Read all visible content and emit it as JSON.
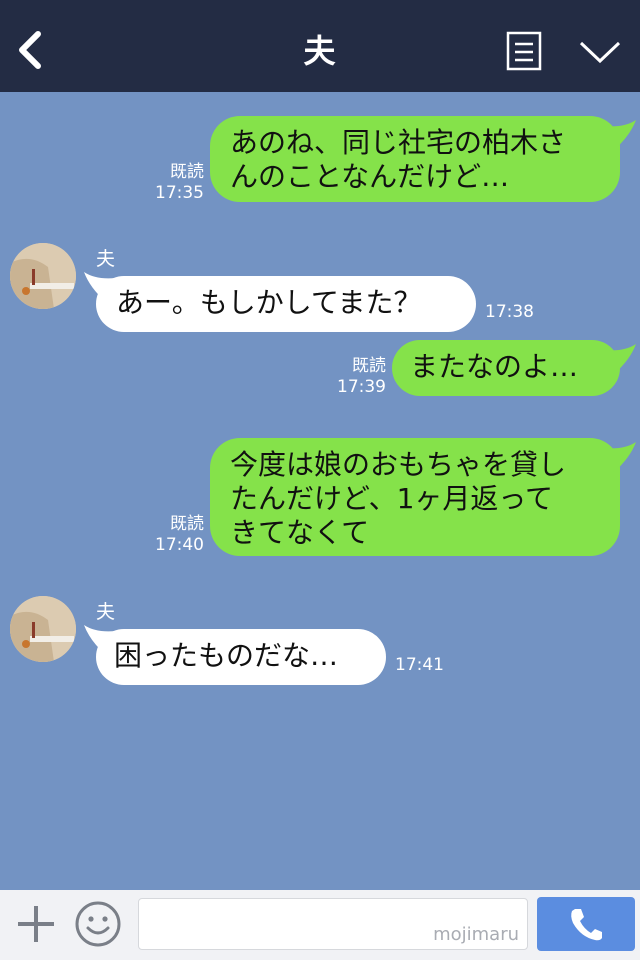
{
  "header": {
    "title": "夫",
    "back_icon": "chevron-left-icon",
    "menu_icon": "memo-icon",
    "collapse_icon": "chevron-down-icon"
  },
  "colors": {
    "header_bg": "#232c44",
    "chat_bg": "#7393c3",
    "outgoing_bubble": "#85e24a",
    "incoming_bubble": "#ffffff",
    "call_button": "#5b8de0"
  },
  "messages": [
    {
      "direction": "out",
      "text": "あのね、同じ社宅の柏木さ\nんのことなんだけど…",
      "read": "既読",
      "time": "17:35"
    },
    {
      "direction": "in",
      "sender": "夫",
      "text": "あー。もしかしてまた？",
      "time": "17:38"
    },
    {
      "direction": "out",
      "text": "またなのよ…",
      "read": "既読",
      "time": "17:39"
    },
    {
      "direction": "out",
      "text": "今度は娘のおもちゃを貸し\nたんだけど、1ヶ月返って\nきてなくて",
      "read": "既読",
      "time": "17:40"
    },
    {
      "direction": "in",
      "sender": "夫",
      "text": "困ったものだな…",
      "time": "17:41"
    }
  ],
  "input": {
    "placeholder": "",
    "watermark": "mojimaru",
    "plus_icon": "plus-icon",
    "emoji_icon": "smiley-icon",
    "call_icon": "phone-icon"
  }
}
